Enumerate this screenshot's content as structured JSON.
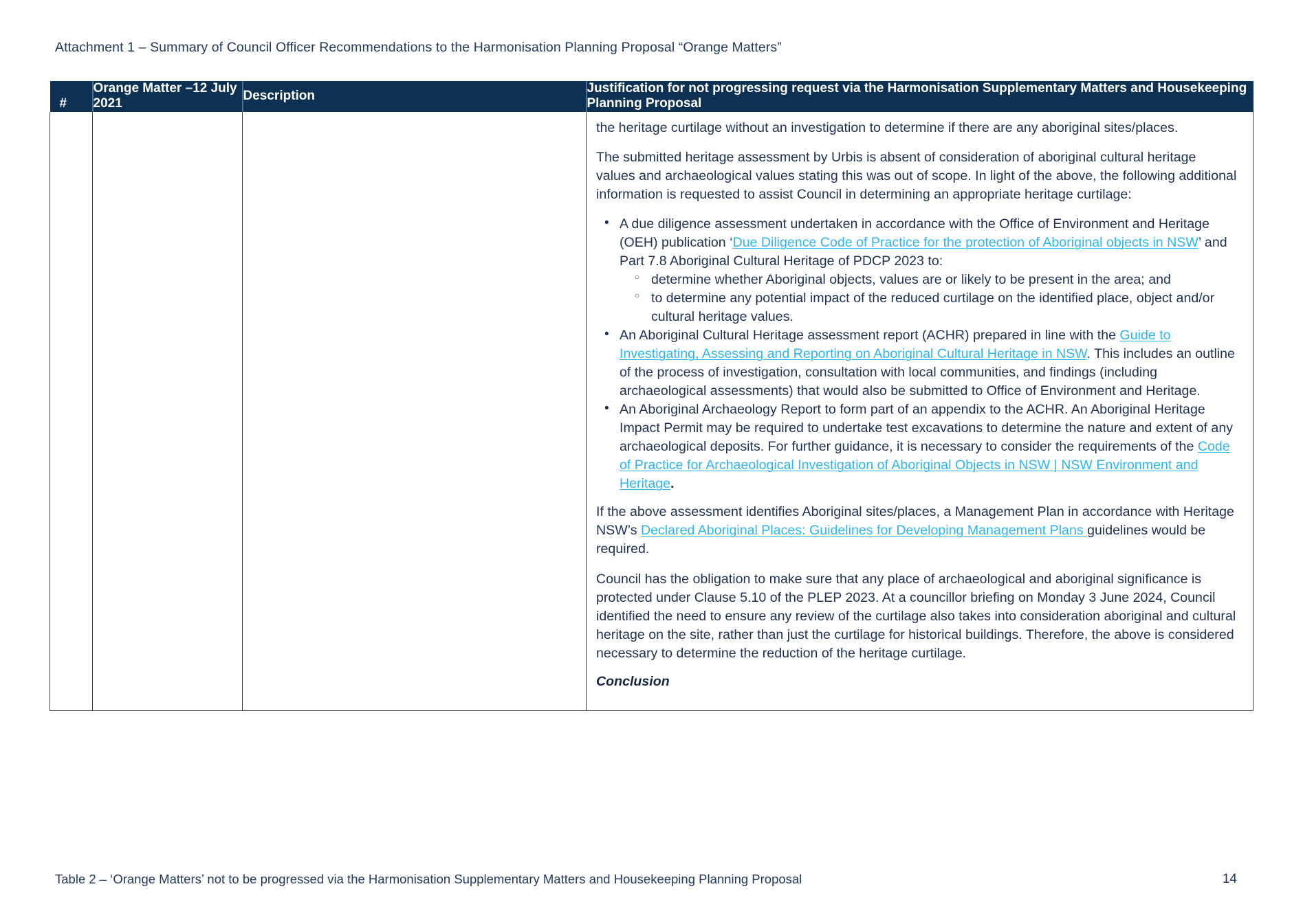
{
  "document": {
    "heading": "Attachment 1 – Summary of Council Officer Recommendations to the Harmonisation Planning Proposal “Orange Matters”",
    "footer_caption": "Table 2 – ‘Orange Matters’ not to be progressed via the Harmonisation Supplementary Matters and Housekeeping Planning Proposal",
    "page_number": "14"
  },
  "colors": {
    "header_background": "#0d3152",
    "header_text": "#ffffff",
    "body_text": "#1f3050",
    "link": "#2eb5ef",
    "table_border": "#3f3f3f"
  },
  "table": {
    "columns": [
      {
        "key": "number",
        "label": "#"
      },
      {
        "key": "matter",
        "label": "Orange Matter –12 July 2021"
      },
      {
        "key": "description",
        "label": "Description"
      },
      {
        "key": "justification",
        "label": "Justification for not progressing request via the Harmonisation Supplementary Matters and Housekeeping Planning Proposal"
      }
    ],
    "row": {
      "number": "",
      "matter": "",
      "description": "",
      "justification": {
        "paragraph_1": "the heritage curtilage without an investigation to determine if there are any aboriginal sites/places.",
        "paragraph_2": "The submitted heritage assessment by Urbis is absent of consideration of aboriginal cultural heritage values and archaeological values stating this was out of scope. In light of the above, the following additional information is requested to assist Council in determining an appropriate heritage curtilage:",
        "bullet_1": {
          "text_before_link": "A due diligence assessment undertaken in accordance with the Office of Environment and Heritage (OEH) publication ‘",
          "link_text": "Due Diligence Code of Practice for the protection of Aboriginal objects in NSW",
          "text_after_link": "’ and Part 7.8 Aboriginal Cultural Heritage of PDCP 2023 to:",
          "sub_bullets": [
            "determine whether Aboriginal objects, values are or likely to be present in the area; and",
            "to determine any potential impact of the reduced curtilage on the identified place, object and/or cultural heritage values."
          ]
        },
        "bullet_2": {
          "text_before_link": "An Aboriginal Cultural Heritage assessment report (ACHR) prepared in line with the ",
          "link_text": "Guide to Investigating, Assessing and Reporting on Aboriginal Cultural Heritage in NSW",
          "text_after_link": ". This includes an outline of the process of investigation, consultation with local communities, and findings (including archaeological assessments) that would also be submitted to Office of Environment and Heritage."
        },
        "bullet_3": {
          "text_before_link": "An Aboriginal Archaeology Report to form part of an appendix to the ACHR. An Aboriginal Heritage Impact Permit may be required to undertake test excavations to determine the nature and extent of any archaeological deposits. For further guidance, it is necessary to consider the requirements of the ",
          "link_text": "Code of Practice for Archaeological Investigation of Aboriginal Objects in NSW | NSW Environment and Heritage",
          "text_after_link": "."
        },
        "paragraph_3": {
          "text_before_link": "If the above assessment identifies Aboriginal sites/places, a Management Plan in accordance with Heritage NSW’s ",
          "link_text": "Declared Aboriginal Places: Guidelines for Developing Management Plans ",
          "text_after_link": "guidelines would be required."
        },
        "paragraph_4": "Council has the obligation to make sure that any place of archaeological and aboriginal significance is protected under Clause 5.10 of the PLEP 2023. At a councillor briefing on Monday 3 June 2024, Council identified the need to ensure any review of the curtilage also takes into consideration aboriginal and cultural heritage on the site, rather than just the curtilage for historical buildings. Therefore, the above is considered necessary to determine the reduction of the heritage curtilage.",
        "conclusion_heading": "Conclusion"
      }
    }
  }
}
